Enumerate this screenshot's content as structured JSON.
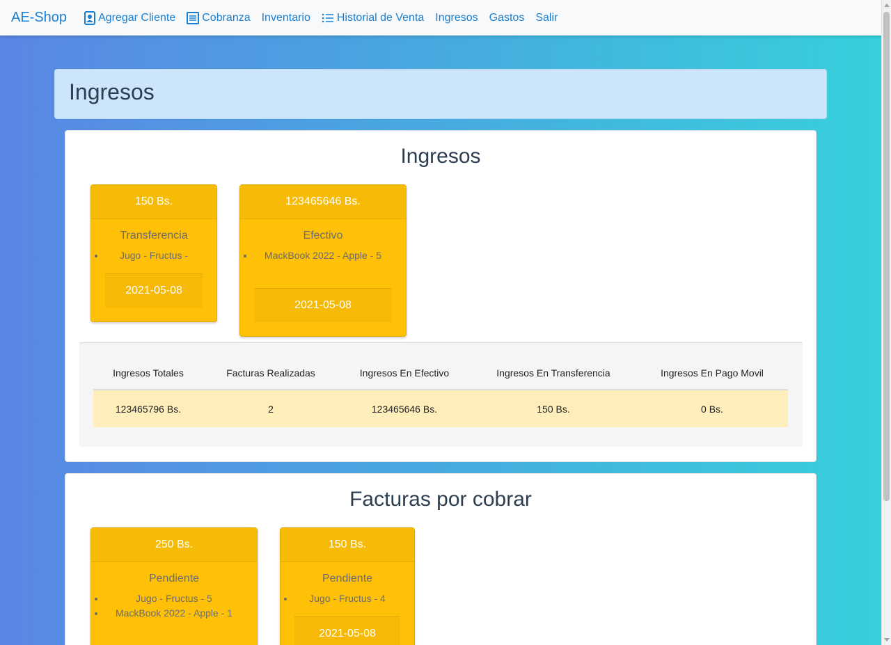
{
  "navbar": {
    "brand": "AE-Shop",
    "items": [
      {
        "label": "Agregar Cliente",
        "icon": "person-badge-icon"
      },
      {
        "label": "Cobranza",
        "icon": "receipt-icon"
      },
      {
        "label": "Inventario",
        "icon": ""
      },
      {
        "label": "Historial de Venta",
        "icon": "list-icon"
      },
      {
        "label": "Ingresos",
        "icon": ""
      },
      {
        "label": "Gastos",
        "icon": ""
      },
      {
        "label": "Salir",
        "icon": ""
      }
    ]
  },
  "page_header": {
    "title": "Ingresos"
  },
  "ingresos": {
    "title": "Ingresos",
    "cards": [
      {
        "amount": "150 Bs.",
        "method": "Transferencia",
        "items": [
          "Jugo - Fructus -"
        ],
        "date": "2021-05-08"
      },
      {
        "amount": "123465646 Bs.",
        "method": "Efectivo",
        "items": [
          "MackBook 2022 - Apple - 5"
        ],
        "date": "2021-05-08"
      }
    ],
    "summary": {
      "headers": [
        "Ingresos Totales",
        "Facturas Realizadas",
        "Ingresos En Efectivo",
        "Ingresos En Transferencia",
        "Ingresos En Pago Movil"
      ],
      "values": [
        "123465796 Bs.",
        "2",
        "123465646 Bs.",
        "150 Bs.",
        "0 Bs."
      ]
    }
  },
  "facturas": {
    "title": "Facturas por cobrar",
    "cards": [
      {
        "amount": "250 Bs.",
        "method": "Pendiente",
        "items": [
          "Jugo - Fructus - 5",
          "MackBook 2022 - Apple - 1"
        ]
      },
      {
        "amount": "150 Bs.",
        "method": "Pendiente",
        "items": [
          "Jugo - Fructus - 4"
        ],
        "date": "2021-05-08"
      }
    ]
  },
  "colors": {
    "link": "#1a7fd0",
    "card": "#ffc107",
    "header_bg": "#cce5fb"
  }
}
